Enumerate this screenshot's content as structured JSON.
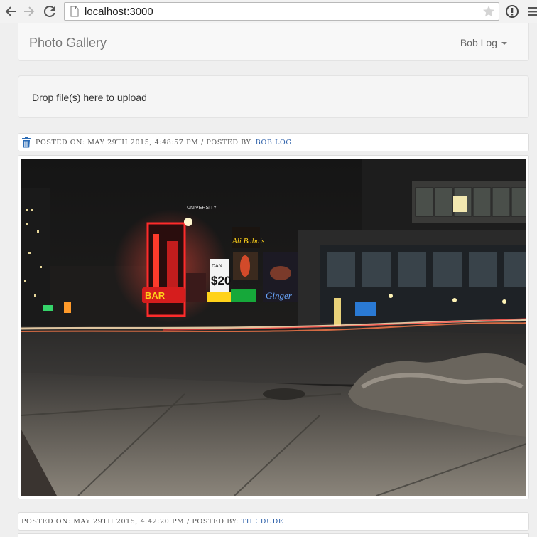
{
  "browser": {
    "url": "localhost:3000"
  },
  "navbar": {
    "brand": "Photo Gallery",
    "user": "Bob Log"
  },
  "dropzone": {
    "text": "Drop file(s) here to upload"
  },
  "posts": [
    {
      "posted_on_label": "Posted on:",
      "date": "May 29th 2015, 4:48:57 pm",
      "posted_by_label": "/ Posted by:",
      "author": "Bob Log",
      "has_delete": true,
      "sign_texts": [
        "UNIVERSITY",
        "Ali Baba's",
        "$20",
        "DAN",
        "Ginger",
        "BAR"
      ]
    },
    {
      "posted_on_label": "Posted on:",
      "date": "May 29th 2015, 4:42:20 pm",
      "posted_by_label": "/ Posted by:",
      "author": "The Dude",
      "has_delete": false
    }
  ],
  "colors": {
    "link": "#2a5ea8",
    "trash": "#2a6bb5",
    "neon_red": "#ff2b2b",
    "neon_yellow": "#ffd21a"
  }
}
